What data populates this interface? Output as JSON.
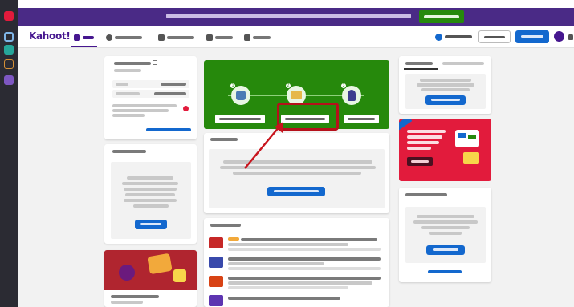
{
  "app": {
    "logo": "Kahoot!"
  },
  "sidebar_rail": {
    "icons": [
      "rail-icon-1",
      "rail-icon-2",
      "rail-icon-3",
      "rail-icon-4",
      "rail-icon-5"
    ]
  },
  "banner": {
    "text": "",
    "cta_label": ""
  },
  "nav": {
    "items": [
      {
        "label": "",
        "icon": "home-icon",
        "active": true
      },
      {
        "label": "",
        "icon": "compass-icon",
        "active": false
      },
      {
        "label": "",
        "icon": "library-icon",
        "active": false
      },
      {
        "label": "",
        "icon": "reports-icon",
        "active": false
      },
      {
        "label": "",
        "icon": "groups-icon",
        "active": false
      }
    ],
    "upgrade_label": "",
    "join_label": "",
    "create_label": "",
    "avatar_initial": ""
  },
  "profile_card": {
    "name": "",
    "subtitle": "",
    "rows": [
      {
        "key": "",
        "value": ""
      },
      {
        "key": "",
        "value": ""
      }
    ],
    "note": "",
    "link": ""
  },
  "left_section": {
    "title": "",
    "body": "",
    "cta": ""
  },
  "left_promo": {
    "caption": ""
  },
  "hero": {
    "kicker": "",
    "title": "",
    "steps": [
      {
        "number": "1",
        "button": ""
      },
      {
        "number": "2",
        "button": ""
      },
      {
        "number": "3",
        "button": ""
      }
    ]
  },
  "collections": {
    "title": "",
    "body": "",
    "cta": ""
  },
  "news": {
    "title": "",
    "items": [
      {
        "title": "",
        "snippet": ""
      },
      {
        "title": "",
        "snippet": ""
      },
      {
        "title": "",
        "snippet": ""
      },
      {
        "title": "",
        "snippet": ""
      }
    ]
  },
  "right_tabs": {
    "tabs": [
      "",
      ""
    ],
    "empty_text": "",
    "cta": ""
  },
  "right_promo": {
    "badge": "",
    "title": "",
    "cta": ""
  },
  "right_section": {
    "title": "",
    "body": "",
    "cta": "",
    "link": ""
  },
  "colors": {
    "brand_purple": "#46178f",
    "banner_bg": "#4a2a86",
    "hero_green": "#26890c",
    "primary_blue": "#1368ce",
    "highlight_red": "#b5111b",
    "promo_red": "#e21b3c",
    "rail_bg": "#2b2b33"
  }
}
